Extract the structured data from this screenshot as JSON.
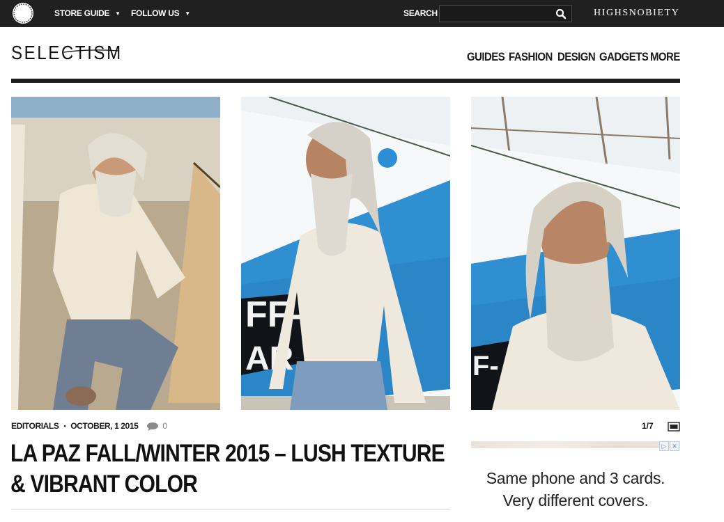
{
  "topbar": {
    "store_guide_label": "STORE GUIDE",
    "follow_us_label": "FOLLOW US",
    "search_label": "SEARCH",
    "search_value": "",
    "partner_brand": "HIGHSNOBIETY"
  },
  "header": {
    "logo_text": "SELECTISM",
    "nav": {
      "guides": "GUIDES",
      "fashion": "FASHION",
      "design": "DESIGN",
      "gadgets": "GADGETS",
      "more": "MORE"
    }
  },
  "gallery": {
    "counter": "1/7",
    "images": [
      {
        "icon": "photo-old-man-crouching-by-sail"
      },
      {
        "icon": "photo-old-man-standing-by-blue-boat"
      },
      {
        "icon": "photo-old-man-closeup-by-boat"
      }
    ]
  },
  "article": {
    "category": "EDITORIALS",
    "separator": "•",
    "date": "OCTOBER, 1 2015",
    "comment_count": "0",
    "title": "LA PAZ FALL/WINTER 2015 – LUSH TEXTURE & VIBRANT COLOR"
  },
  "ad": {
    "line1": "Same phone and 3 cards.",
    "line2": "Very different covers.",
    "choice_icon": "▷",
    "close_icon": "✕"
  },
  "colors": {
    "topbar_bg": "#202020",
    "header_rule": "#1c1c1c",
    "boat_blue": "#2f8fd0"
  }
}
